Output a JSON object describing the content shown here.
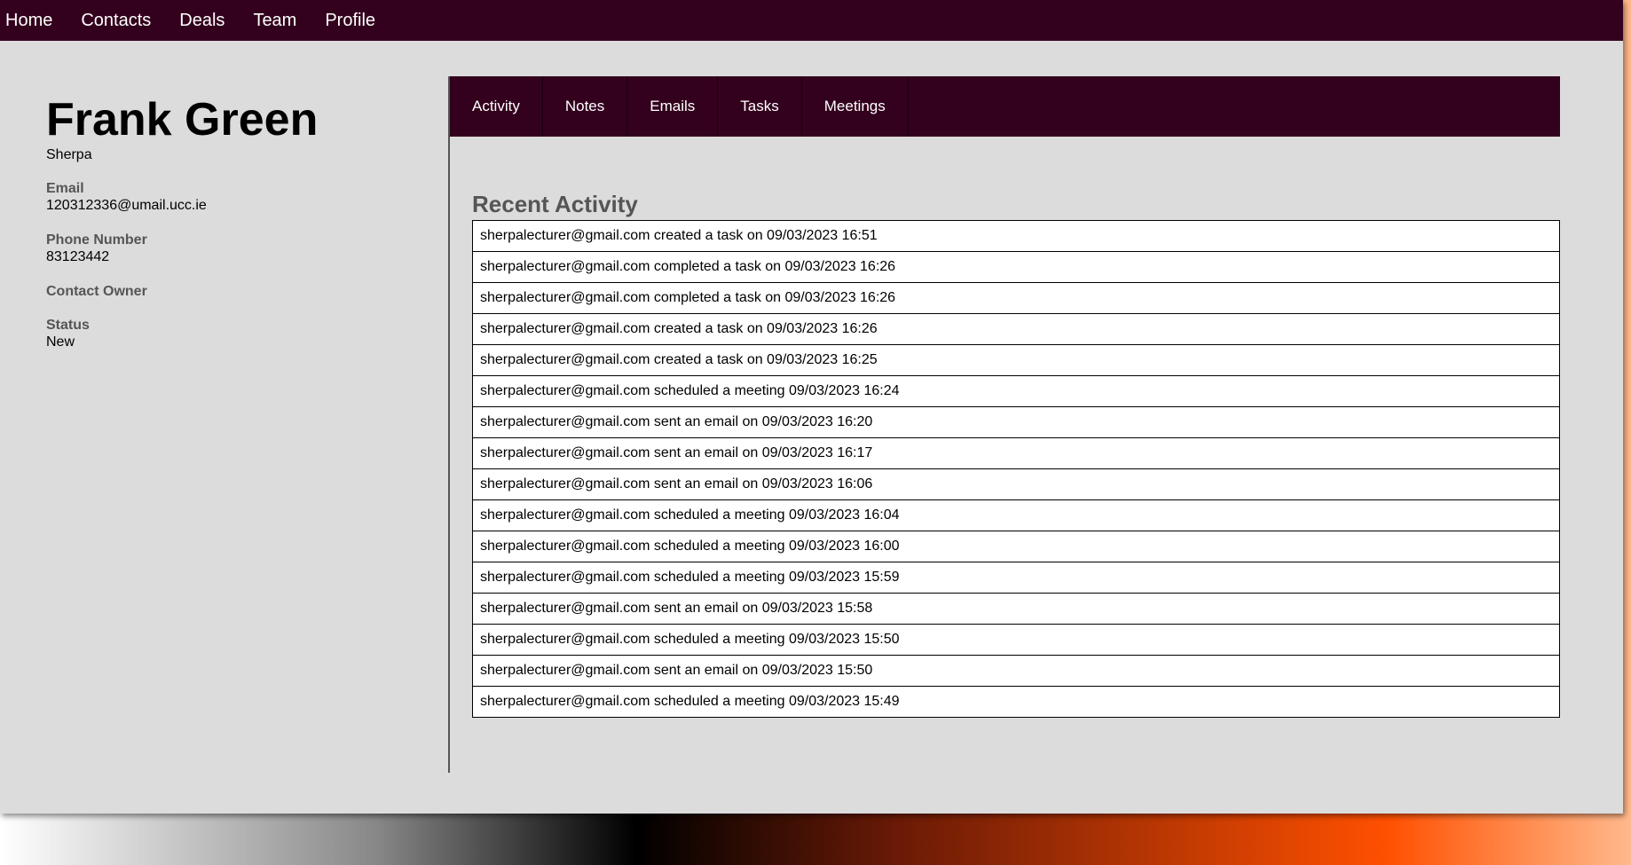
{
  "nav": {
    "items": [
      "Home",
      "Contacts",
      "Deals",
      "Team",
      "Profile"
    ]
  },
  "contact": {
    "name": "Frank Green",
    "company": "Sherpa",
    "email_label": "Email",
    "email": "120312336@umail.ucc.ie",
    "phone_label": "Phone Number",
    "phone": "83123442",
    "owner_label": "Contact Owner",
    "owner": "",
    "status_label": "Status",
    "status": "New"
  },
  "tabs": [
    "Activity",
    "Notes",
    "Emails",
    "Tasks",
    "Meetings"
  ],
  "activity": {
    "title": "Recent Activity",
    "items": [
      "sherpalecturer@gmail.com created a task on 09/03/2023 16:51",
      "sherpalecturer@gmail.com completed a task on 09/03/2023 16:26",
      "sherpalecturer@gmail.com completed a task on 09/03/2023 16:26",
      "sherpalecturer@gmail.com created a task on 09/03/2023 16:26",
      "sherpalecturer@gmail.com created a task on 09/03/2023 16:25",
      "sherpalecturer@gmail.com scheduled a meeting 09/03/2023 16:24",
      "sherpalecturer@gmail.com sent an email on 09/03/2023 16:20",
      "sherpalecturer@gmail.com sent an email on 09/03/2023 16:17",
      "sherpalecturer@gmail.com sent an email on 09/03/2023 16:06",
      "sherpalecturer@gmail.com scheduled a meeting 09/03/2023 16:04",
      "sherpalecturer@gmail.com scheduled a meeting 09/03/2023 16:00",
      "sherpalecturer@gmail.com scheduled a meeting 09/03/2023 15:59",
      "sherpalecturer@gmail.com sent an email on 09/03/2023 15:58",
      "sherpalecturer@gmail.com scheduled a meeting 09/03/2023 15:50",
      "sherpalecturer@gmail.com sent an email on 09/03/2023 15:50",
      "sherpalecturer@gmail.com scheduled a meeting 09/03/2023 15:49"
    ]
  },
  "colors": {
    "nav_bg": "#33001d",
    "page_bg": "#dcdcdc",
    "label_gray": "#555555"
  }
}
